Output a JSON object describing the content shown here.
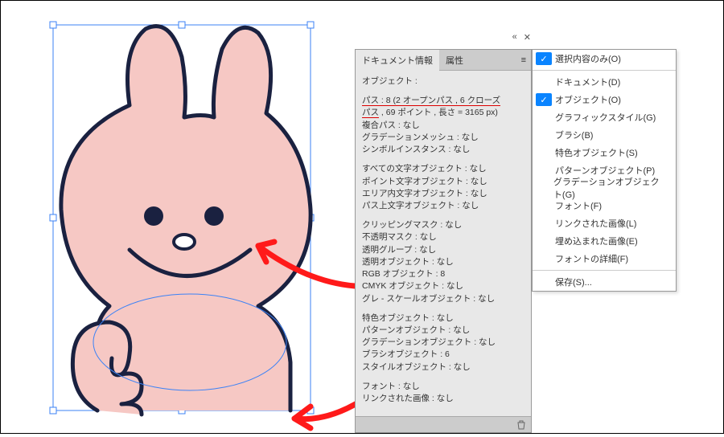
{
  "panel": {
    "tabs": {
      "doc_info": "ドキュメント情報",
      "attributes": "属性"
    },
    "header_line": "オブジェクト :",
    "path_line1a": "パス : 8 (2 オープンパス , 6 クローズ",
    "path_line1b": "パス",
    "path_line1c": " , 69 ポイント , 長さ = 3165 px)",
    "compound_path": "複合パス : なし",
    "grad_mesh": "グラデーションメッシュ : なし",
    "symbol_inst": "シンボルインスタンス : なし",
    "all_text": "すべての文字オブジェクト : なし",
    "point_text": "ポイント文字オブジェクト : なし",
    "area_text": "エリア内文字オブジェクト : なし",
    "path_text": "パス上文字オブジェクト : なし",
    "clip_mask": "クリッピングマスク : なし",
    "opacity_mask": "不透明マスク : なし",
    "trans_group": "透明グループ : なし",
    "trans_obj": "透明オブジェクト : なし",
    "rgb_obj": "RGB オブジェクト : 8",
    "cmyk_obj": "CMYK オブジェクト : なし",
    "gray_obj": "グレ - スケールオブジェクト : なし",
    "spot_obj": "特色オブジェクト : なし",
    "pattern_obj": "パターンオブジェクト : なし",
    "grad_obj": "グラデーションオブジェクト : なし",
    "brush_obj": "ブラシオブジェクト : 6",
    "style_obj": "スタイルオブジェクト : なし",
    "font": "フォント : なし",
    "linked_img": "リンクされた画像 : なし"
  },
  "flyout": {
    "selection_only": "選択内容のみ(O)",
    "document": "ドキュメント(D)",
    "object": "オブジェクト(O)",
    "graphic_style": "グラフィックスタイル(G)",
    "brush": "ブラシ(B)",
    "spot_object": "特色オブジェクト(S)",
    "pattern_object": "パターンオブジェクト(P)",
    "gradation_object": "グラデーションオブジェクト(G)",
    "font_item": "フォント(F)",
    "linked_image": "リンクされた画像(L)",
    "embedded_image": "埋め込まれた画像(E)",
    "font_detail": "フォントの詳細(F)",
    "save": "保存(S)..."
  },
  "icons": {
    "check": "✓",
    "collapse": "«",
    "close": "✕",
    "menu": "≡"
  }
}
